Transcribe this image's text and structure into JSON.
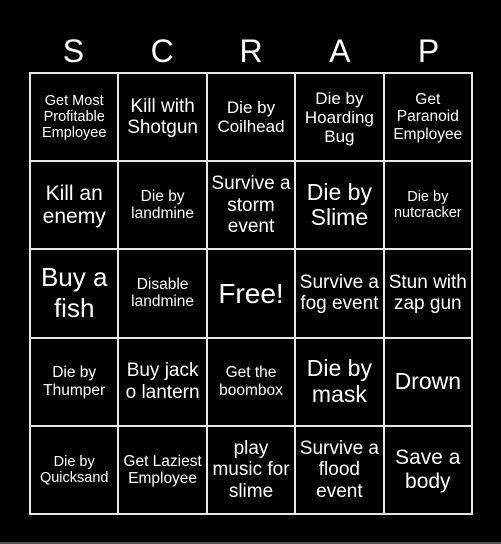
{
  "title_letters": [
    "S",
    "C",
    "R",
    "A",
    "P"
  ],
  "cells": [
    {
      "text": "Get Most Profitable Employee",
      "size": "s14"
    },
    {
      "text": "Kill with Shotgun",
      "size": "s19"
    },
    {
      "text": "Die by Coilhead",
      "size": "s17"
    },
    {
      "text": "Die by Hoarding Bug",
      "size": "s17"
    },
    {
      "text": "Get Paranoid Employee",
      "size": "s15"
    },
    {
      "text": "Kill an enemy",
      "size": "s21"
    },
    {
      "text": "Die by landmine",
      "size": "s15"
    },
    {
      "text": "Survive a storm event",
      "size": "s19"
    },
    {
      "text": "Die by Slime",
      "size": "s23"
    },
    {
      "text": "Die by nutcracker",
      "size": "s14"
    },
    {
      "text": "Buy a fish",
      "size": "s26"
    },
    {
      "text": "Disable landmine",
      "size": "s15"
    },
    {
      "text": "Free!",
      "size": "s28"
    },
    {
      "text": "Survive a fog event",
      "size": "s19"
    },
    {
      "text": "Stun with zap gun",
      "size": "s19"
    },
    {
      "text": "Die by Thumper",
      "size": "s15"
    },
    {
      "text": "Buy jack o lantern",
      "size": "s19"
    },
    {
      "text": "Get the boombox",
      "size": "s15"
    },
    {
      "text": "Die by mask",
      "size": "s23"
    },
    {
      "text": "Drown",
      "size": "s23"
    },
    {
      "text": "Die by Quicksand",
      "size": "s14"
    },
    {
      "text": "Get Laziest Employee",
      "size": "s15"
    },
    {
      "text": "play music for slime",
      "size": "s19"
    },
    {
      "text": "Survive a flood event",
      "size": "s19"
    },
    {
      "text": "Save a body",
      "size": "s21"
    }
  ],
  "colors": {
    "background": "#000000",
    "grid_line": "#e8e8e8",
    "text": "#ffffff"
  }
}
